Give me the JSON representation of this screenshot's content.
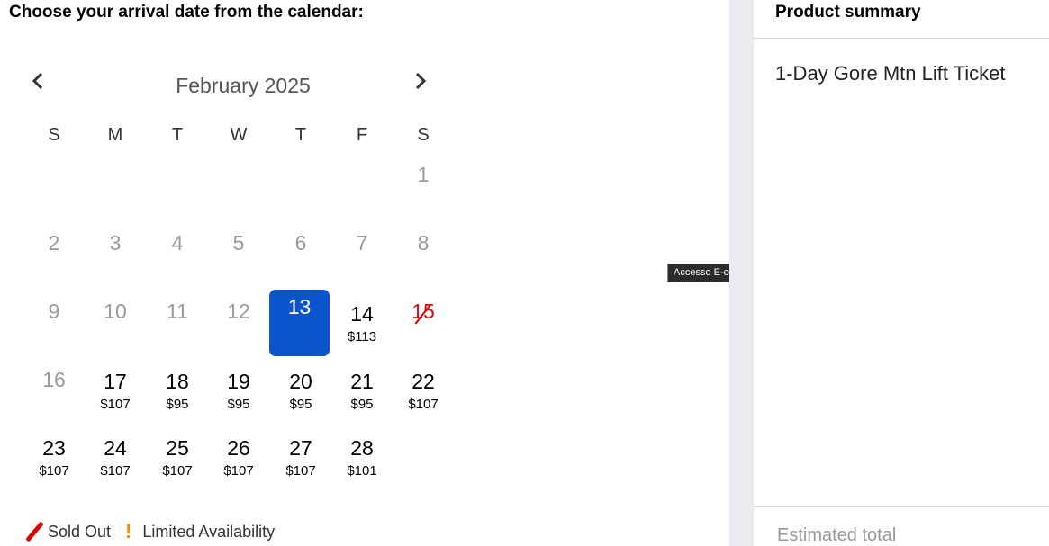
{
  "calendar": {
    "prompt": "Choose your arrival date from the calendar:",
    "month_label": "February 2025",
    "prev_icon": "chevron-left-icon",
    "next_icon": "chevron-right-icon",
    "weekdays": [
      "S",
      "M",
      "T",
      "W",
      "T",
      "F",
      "S"
    ],
    "days": {
      "d1": {
        "num": "1"
      },
      "d2": {
        "num": "2"
      },
      "d3": {
        "num": "3"
      },
      "d4": {
        "num": "4"
      },
      "d5": {
        "num": "5"
      },
      "d6": {
        "num": "6"
      },
      "d7": {
        "num": "7"
      },
      "d8": {
        "num": "8"
      },
      "d9": {
        "num": "9"
      },
      "d10": {
        "num": "10"
      },
      "d11": {
        "num": "11"
      },
      "d12": {
        "num": "12"
      },
      "d13": {
        "num": "13"
      },
      "d14": {
        "num": "14",
        "price": "$113"
      },
      "d15": {
        "num": "15",
        "status": "sold-out"
      },
      "d16": {
        "num": "16"
      },
      "d17": {
        "num": "17",
        "price": "$107"
      },
      "d18": {
        "num": "18",
        "price": "$95"
      },
      "d19": {
        "num": "19",
        "price": "$95"
      },
      "d20": {
        "num": "20",
        "price": "$95"
      },
      "d21": {
        "num": "21",
        "price": "$95"
      },
      "d22": {
        "num": "22",
        "price": "$107"
      },
      "d23": {
        "num": "23",
        "price": "$107"
      },
      "d24": {
        "num": "24",
        "price": "$107"
      },
      "d25": {
        "num": "25",
        "price": "$107"
      },
      "d26": {
        "num": "26",
        "price": "$107"
      },
      "d27": {
        "num": "27",
        "price": "$107"
      },
      "d28": {
        "num": "28",
        "price": "$101"
      }
    },
    "selected_day": "13",
    "legend": {
      "sold_out": "Sold Out",
      "limited": "Limited Availability"
    },
    "colors": {
      "selected": "#0b54cc",
      "sold_out": "#e00000",
      "limited": "#ff8a00"
    }
  },
  "summary": {
    "title": "Product summary",
    "product_name": "1-Day Gore Mtn Lift Ticket",
    "estimated_total_label": "Estimated total"
  },
  "overlay": {
    "tooltip": "Accesso E-commerce Store Overlay"
  }
}
